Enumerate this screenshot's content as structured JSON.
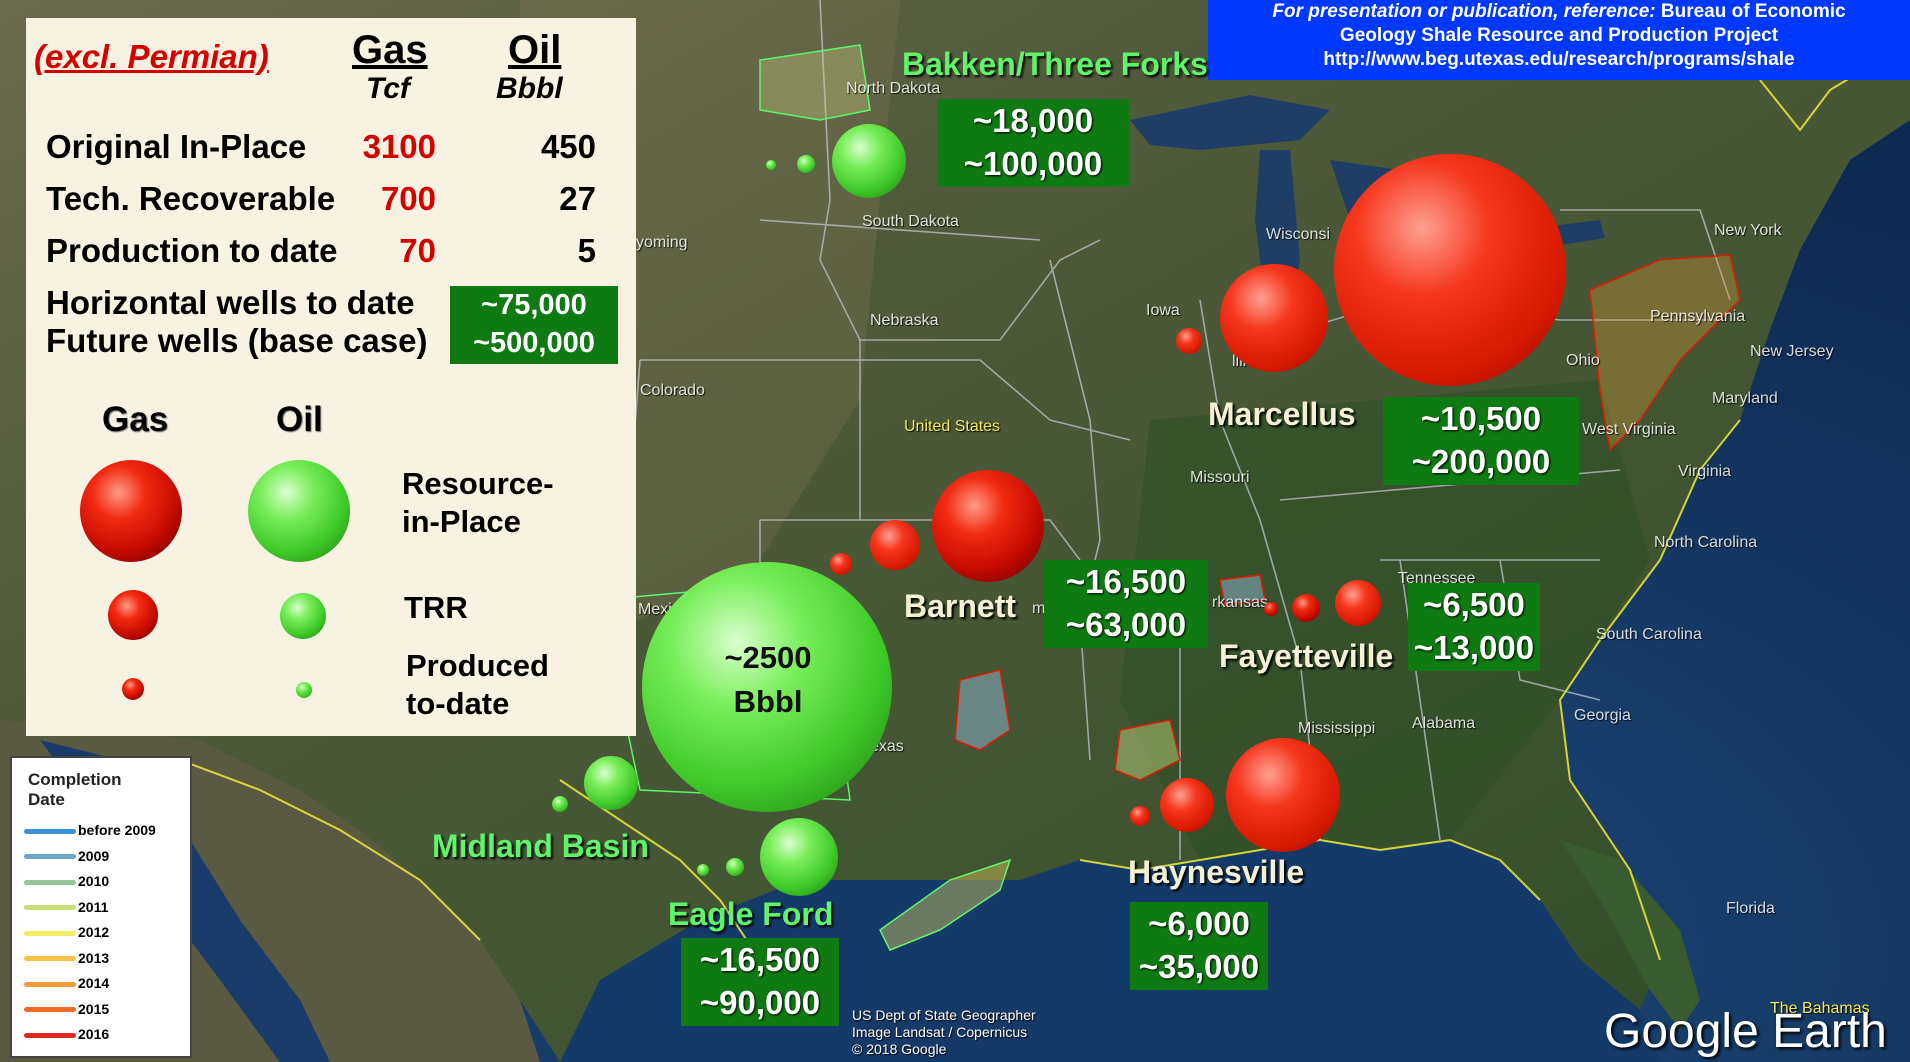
{
  "banner": {
    "line1_italic": "For presentation or publication, reference:",
    "line1_rest": " Bureau of Economic",
    "line2": "Geology Shale Resource and Production Project",
    "url": "http://www.beg.utexas.edu/research/programs/shale"
  },
  "summary": {
    "excl": "(excl. Permian)",
    "gas_header": "Gas",
    "gas_unit": "Tcf",
    "oil_header": "Oil",
    "oil_unit": "Bbbl",
    "rows": [
      {
        "label": "Original In-Place",
        "gas": "3100",
        "oil": "450"
      },
      {
        "label": "Tech. Recoverable",
        "gas": "700",
        "oil": "27"
      },
      {
        "label": "Production to date",
        "gas": "70",
        "oil": "5"
      }
    ],
    "wells_label_1": "Horizontal wells to date",
    "wells_label_2": "Future wells (base case)",
    "wells_value_1": "~75,000",
    "wells_value_2": "~500,000"
  },
  "legend": {
    "gas": "Gas",
    "oil": "Oil",
    "resource_1": "Resource-",
    "resource_2": "in-Place",
    "trr": "TRR",
    "produced_1": "Produced",
    "produced_2": "to-date"
  },
  "plays": {
    "bakken": {
      "name": "Bakken/Three Forks",
      "wells_to_date": "~18,000",
      "future_wells": "~100,000"
    },
    "marcellus": {
      "name": "Marcellus",
      "wells_to_date": "~10,500",
      "future_wells": "~200,000"
    },
    "barnett": {
      "name": "Barnett",
      "wells_to_date": "~16,500",
      "future_wells": "~63,000"
    },
    "fayetteville": {
      "name": "Fayetteville",
      "wells_to_date": "~6,500",
      "future_wells": "~13,000"
    },
    "haynesville": {
      "name": "Haynesville",
      "wells_to_date": "~6,000",
      "future_wells": "~35,000"
    },
    "eagle_ford": {
      "name": "Eagle Ford",
      "wells_to_date": "~16,500",
      "future_wells": "~90,000"
    },
    "midland": {
      "name": "Midland Basin",
      "bubble_value": "~2500",
      "bubble_unit": "Bbbl"
    }
  },
  "states": {
    "north_dakota": "North Dakota",
    "south_dakota": "South Dakota",
    "wyoming": "yoming",
    "nebraska": "Nebraska",
    "colorado": "Colorado",
    "united_states": "United States",
    "iowa": "Iowa",
    "wisconsin": "Wisconsi",
    "illinois": "llinois",
    "ohio": "Ohio",
    "missouri": "Missouri",
    "new_york": "New York",
    "pennsylvania": "Pennsylvania",
    "new_jersey": "New Jersey",
    "maryland": "Maryland",
    "west_virginia": "West Virginia",
    "virginia": "Virginia",
    "north_carolina": "North Carolina",
    "tennessee": "Tennessee",
    "arkansas": "rkansas",
    "south_carolina": "South Carolina",
    "georgia": "Georgia",
    "alabama": "Alabama",
    "mississippi": "Mississippi",
    "texas": "exas",
    "mexico": "Mexi",
    "oklahoma": "m",
    "florida": "Florida",
    "bahamas": "The Bahamas"
  },
  "completion_legend": {
    "title_1": "Completion",
    "title_2": "Date",
    "items": [
      {
        "label": "before 2009",
        "color": "#3d8fd6"
      },
      {
        "label": "2009",
        "color": "#6fa6c4"
      },
      {
        "label": "2010",
        "color": "#93c49b"
      },
      {
        "label": "2011",
        "color": "#c9df7a"
      },
      {
        "label": "2012",
        "color": "#f3ee63"
      },
      {
        "label": "2013",
        "color": "#f8bf4a"
      },
      {
        "label": "2014",
        "color": "#f79a38"
      },
      {
        "label": "2015",
        "color": "#f06a2a"
      },
      {
        "label": "2016",
        "color": "#e0261d"
      }
    ]
  },
  "credit": {
    "line1": "US Dept of State Geographer",
    "line2": "Image Landsat / Copernicus",
    "line3": "© 2018 Google"
  },
  "watermark": "Google Earth",
  "colors": {
    "gas": "#e01a00",
    "oil": "#4fdc34",
    "box_green": "#0f7a12",
    "banner_blue": "#0038ff",
    "panel": "#f7f2e2"
  }
}
